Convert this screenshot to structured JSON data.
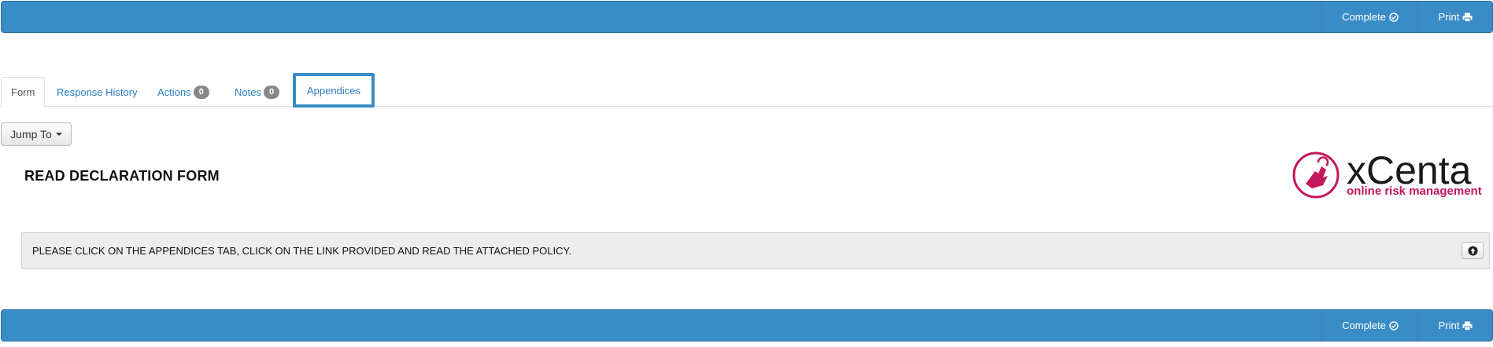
{
  "toolbar": {
    "complete_label": "Complete",
    "print_label": "Print"
  },
  "tabs": [
    {
      "label": "Form"
    },
    {
      "label": "Response History"
    },
    {
      "label": "Actions",
      "count": "0"
    },
    {
      "label": "Notes",
      "count": "0"
    },
    {
      "label": "Appendices"
    }
  ],
  "jump_to": {
    "label": "Jump To"
  },
  "form": {
    "title": "READ DECLARATION FORM"
  },
  "logo": {
    "name": "xCenta",
    "tagline": "online risk management",
    "colors": {
      "primary": "#c2185b",
      "text": "#1a1a1a"
    }
  },
  "instruction": {
    "text": "PLEASE CLICK ON THE APPENDICES TAB, CLICK ON THE LINK PROVIDED AND READ THE ATTACHED POLICY.",
    "button_icon": "arrow-up-circle-icon"
  },
  "colors": {
    "bar": "#3a8cc6",
    "link": "#2a7dc0",
    "highlight": "#3a8cc6"
  }
}
